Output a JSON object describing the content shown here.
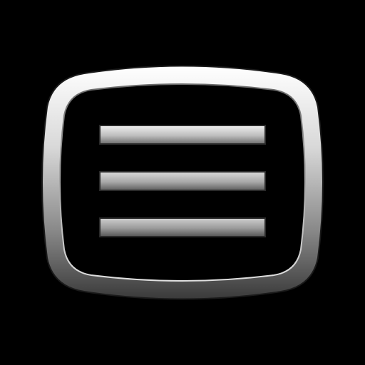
{
  "icon": {
    "name": "menu-tv-icon",
    "colors": {
      "background": "#000000",
      "frame_light": "#FFFFFF",
      "frame_dark": "#2A2A2A",
      "bar_light": "#E6E6E6",
      "bar_dark": "#5A5A5A"
    }
  }
}
